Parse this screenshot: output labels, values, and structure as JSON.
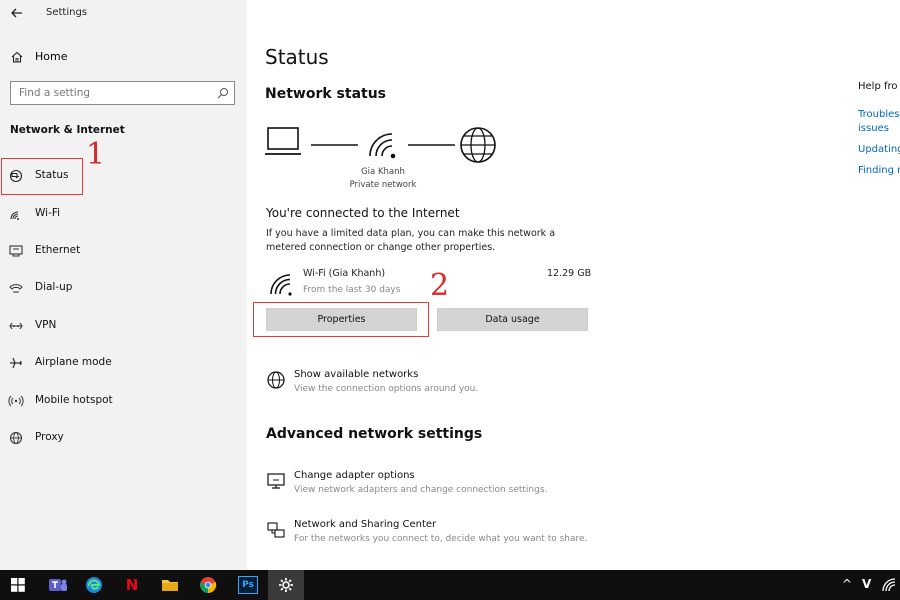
{
  "window": {
    "title": "Settings"
  },
  "sidebar": {
    "home_label": "Home",
    "search_placeholder": "Find a setting",
    "section_heading": "Network & Internet",
    "items": [
      {
        "label": "Status",
        "icon": "globe-status-icon"
      },
      {
        "label": "Wi-Fi",
        "icon": "wifi-icon"
      },
      {
        "label": "Ethernet",
        "icon": "ethernet-icon"
      },
      {
        "label": "Dial-up",
        "icon": "dialup-icon"
      },
      {
        "label": "VPN",
        "icon": "vpn-icon"
      },
      {
        "label": "Airplane mode",
        "icon": "airplane-icon"
      },
      {
        "label": "Mobile hotspot",
        "icon": "hotspot-icon"
      },
      {
        "label": "Proxy",
        "icon": "proxy-globe-icon"
      }
    ]
  },
  "annotations": {
    "step1": "1",
    "step2": "2",
    "color": "#d42a2a"
  },
  "main": {
    "title": "Status",
    "network_status_heading": "Network status",
    "network_name": "Gia Khanh",
    "network_type": "Private network",
    "connected_heading": "You're connected to the Internet",
    "connected_text": "If you have a limited data plan, you can make this network a metered connection or change other properties.",
    "wifi": {
      "name": "Wi-Fi (Gia Khanh)",
      "period": "From the last 30 days",
      "usage": "12.29 GB"
    },
    "buttons": {
      "properties": "Properties",
      "data_usage": "Data usage"
    },
    "show_networks": {
      "title": "Show available networks",
      "desc": "View the connection options around you."
    },
    "advanced_heading": "Advanced network settings",
    "adapter_options": {
      "title": "Change adapter options",
      "desc": "View network adapters and change connection settings."
    },
    "sharing_center": {
      "title": "Network and Sharing Center",
      "desc": "For the networks you connect to, decide what you want to share."
    }
  },
  "help": {
    "title": "Help fro",
    "links": [
      "Troublesi",
      "issues",
      "Updating",
      "Finding n"
    ]
  },
  "taskbar": {
    "items": [
      "windows-start-icon",
      "teams-icon",
      "edge-icon",
      "netflix-icon",
      "file-explorer-icon",
      "chrome-icon",
      "photoshop-icon",
      "settings-gear-icon"
    ],
    "netflix_label": "N",
    "photoshop_label": "Ps",
    "tray_chevron": "^",
    "tray_v": "V"
  },
  "colors": {
    "accent_link": "#0067c0",
    "sidebar_bg": "#f2f2f2",
    "button_bg": "#d4d4d4",
    "taskbar_bg": "#0f0f0f"
  }
}
